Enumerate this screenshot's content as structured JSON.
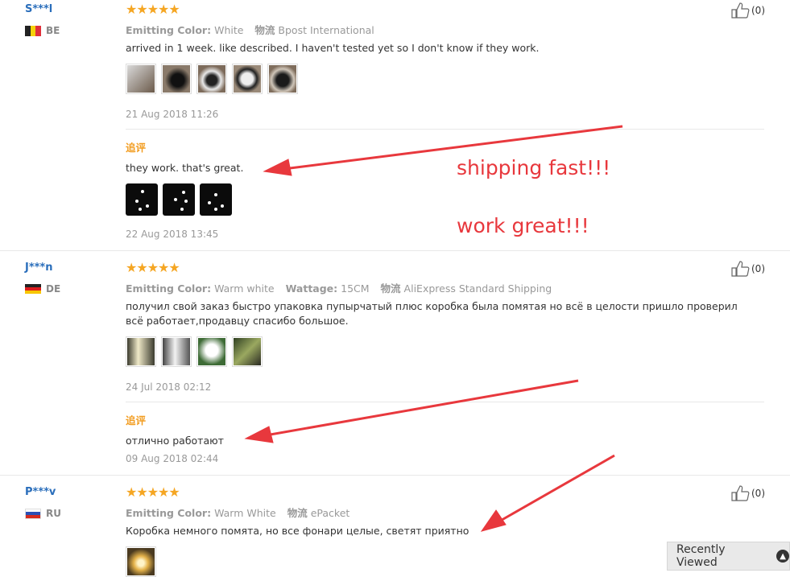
{
  "reviews": [
    {
      "user": "S***l",
      "country": "BE",
      "stars": "★★★★★",
      "attrs": [
        {
          "label": "Emitting Color:",
          "value": "White"
        },
        {
          "label": "物流",
          "value": "Bpost International"
        }
      ],
      "text": "arrived in 1 week. like described. I haven't tested yet so I don't know if they work.",
      "date": "21 Aug 2018 11:26",
      "likes": "(0)",
      "additional": {
        "label": "追评",
        "text": "they work. that's great.",
        "date": "22 Aug 2018 13:45"
      }
    },
    {
      "user": "J***n",
      "country": "DE",
      "stars": "★★★★★",
      "attrs": [
        {
          "label": "Emitting Color:",
          "value": "Warm white"
        },
        {
          "label": "Wattage:",
          "value": "15CM"
        },
        {
          "label": "物流",
          "value": "AliExpress Standard Shipping"
        }
      ],
      "text": "получил свой заказ быстро упаковка пупырчатый плюс коробка была помятая но всё в целости пришло проверил всё работает,продавцу спасибо большое.",
      "date": "24 Jul 2018 02:12",
      "likes": "(0)",
      "additional": {
        "label": "追评",
        "text": "отлично работают",
        "date": "09 Aug 2018 02:44"
      }
    },
    {
      "user": "P***v",
      "country": "RU",
      "stars": "★★★★★",
      "attrs": [
        {
          "label": "Emitting Color:",
          "value": "Warm White"
        },
        {
          "label": "物流",
          "value": "ePacket"
        }
      ],
      "text": "Коробка немного помята, но все фонари целые, светят приятно",
      "likes": "(0)"
    }
  ],
  "annotations": {
    "line1": "shipping fast!!!",
    "line2": "work great!!!",
    "color": "#e8383d"
  },
  "recently_viewed": {
    "label": "Recently Viewed",
    "icon": "chevron-up-icon"
  }
}
